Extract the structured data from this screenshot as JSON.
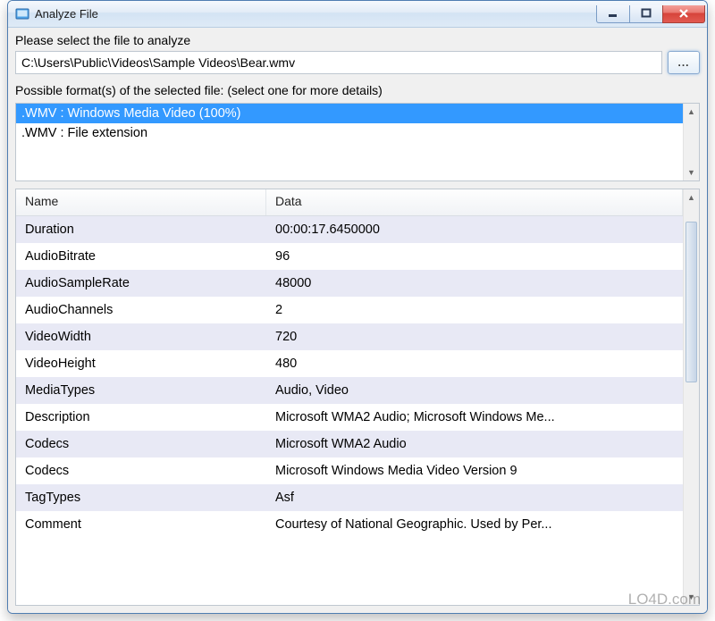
{
  "window": {
    "title": "Analyze File"
  },
  "file_select": {
    "label": "Please select the file to analyze",
    "path": "C:\\Users\\Public\\Videos\\Sample Videos\\Bear.wmv",
    "browse_label": "..."
  },
  "formats": {
    "label": "Possible format(s) of the selected file: (select one for more details)",
    "items": [
      {
        "text": ".WMV : Windows Media Video (100%)",
        "selected": true
      },
      {
        "text": ".WMV : File extension",
        "selected": false
      }
    ]
  },
  "details": {
    "headers": {
      "name": "Name",
      "data": "Data"
    },
    "rows": [
      {
        "name": "Duration",
        "data": "00:00:17.6450000"
      },
      {
        "name": "AudioBitrate",
        "data": "96"
      },
      {
        "name": "AudioSampleRate",
        "data": "48000"
      },
      {
        "name": "AudioChannels",
        "data": "2"
      },
      {
        "name": "VideoWidth",
        "data": "720"
      },
      {
        "name": "VideoHeight",
        "data": "480"
      },
      {
        "name": "MediaTypes",
        "data": "Audio, Video"
      },
      {
        "name": "Description",
        "data": "Microsoft WMA2 Audio; Microsoft Windows Me..."
      },
      {
        "name": "Codecs",
        "data": "Microsoft WMA2 Audio"
      },
      {
        "name": "Codecs",
        "data": "Microsoft Windows Media Video Version 9"
      },
      {
        "name": "TagTypes",
        "data": "Asf"
      },
      {
        "name": "Comment",
        "data": "Courtesy of National Geographic.  Used by Per..."
      }
    ]
  },
  "watermark": "LO4D.com"
}
